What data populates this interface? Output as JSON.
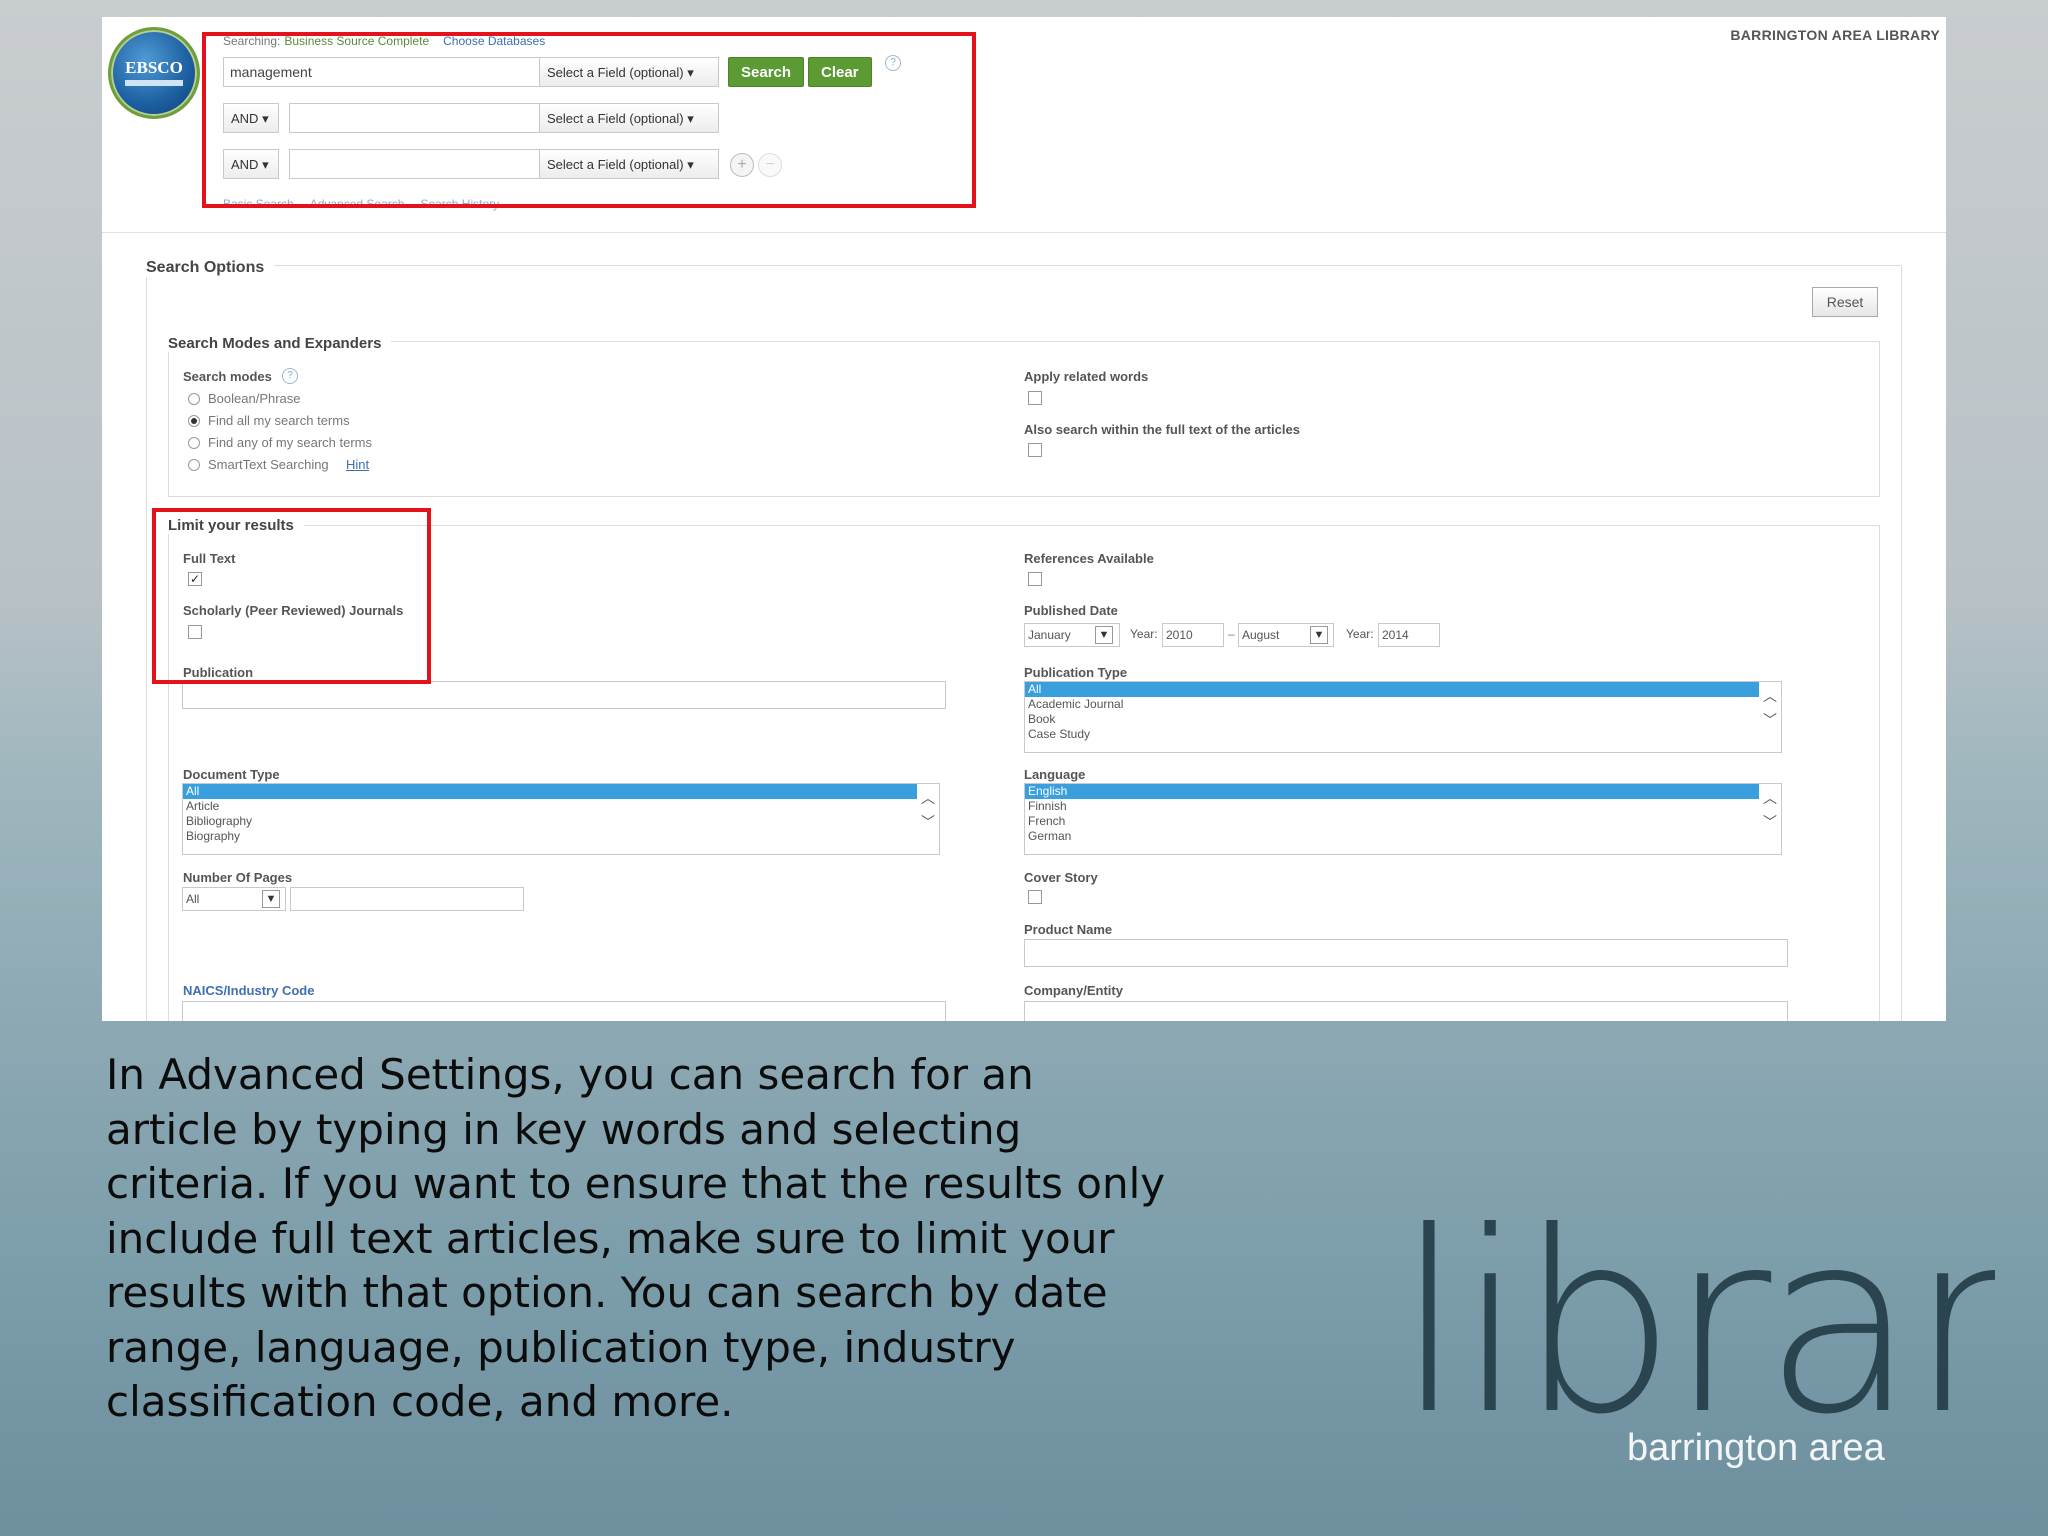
{
  "header": {
    "logo_text": "EBSCO",
    "library_name": "BARRINGTON AREA LIBRARY",
    "searching_label": "Searching:",
    "database": "Business Source Complete",
    "choose_db": "Choose Databases"
  },
  "search": {
    "rows": [
      {
        "value": "management",
        "field": "Select a Field (optional)"
      },
      {
        "operator": "AND",
        "value": "",
        "field": "Select a Field (optional)"
      },
      {
        "operator": "AND",
        "value": "",
        "field": "Select a Field (optional)"
      }
    ],
    "search_label": "Search",
    "clear_label": "Clear",
    "help": "?",
    "links": [
      "Basic Search",
      "Advanced Search",
      "Search History"
    ]
  },
  "options": {
    "title": "Search Options",
    "reset": "Reset",
    "modes_title": "Search Modes and Expanders",
    "modes_label": "Search modes",
    "modes": [
      "Boolean/Phrase",
      "Find all my search terms",
      "Find any of my search terms",
      "SmartText Searching"
    ],
    "hint": "Hint",
    "apply_related": "Apply related words",
    "also_search": "Also search within the full text of the articles"
  },
  "limits": {
    "title": "Limit your results",
    "full_text": "Full Text",
    "scholarly": "Scholarly (Peer Reviewed) Journals",
    "publication": "Publication",
    "references": "References Available",
    "published_date": "Published Date",
    "date_from_month": "January",
    "year_label": "Year:",
    "date_from_year": "2010",
    "dash": "–",
    "date_to_month": "August",
    "date_to_year": "2014",
    "pub_type_label": "Publication Type",
    "pub_types": [
      "All",
      "Academic Journal",
      "Book",
      "Case Study"
    ],
    "doc_type_label": "Document Type",
    "doc_types": [
      "All",
      "Article",
      "Bibliography",
      "Biography"
    ],
    "language_label": "Language",
    "languages": [
      "English",
      "Finnish",
      "French",
      "German"
    ],
    "pages_label": "Number Of Pages",
    "pages_value": "All",
    "cover_story": "Cover Story",
    "product_name": "Product Name",
    "naics": "NAICS/Industry Code",
    "company": "Company/Entity"
  },
  "caption": "In Advanced Settings, you can search for an article by typing in key words and selecting criteria. If you want to ensure that the results only include full text articles, make sure to limit your results with that option. You can search by date range, language, publication type, industry classification code, and more.",
  "brand": {
    "word": "library",
    "sub": "barrington area"
  },
  "colors": {
    "highlight_box": "#e5121b",
    "button_green": "#5c9a34",
    "list_selection": "#3aa0dd"
  }
}
